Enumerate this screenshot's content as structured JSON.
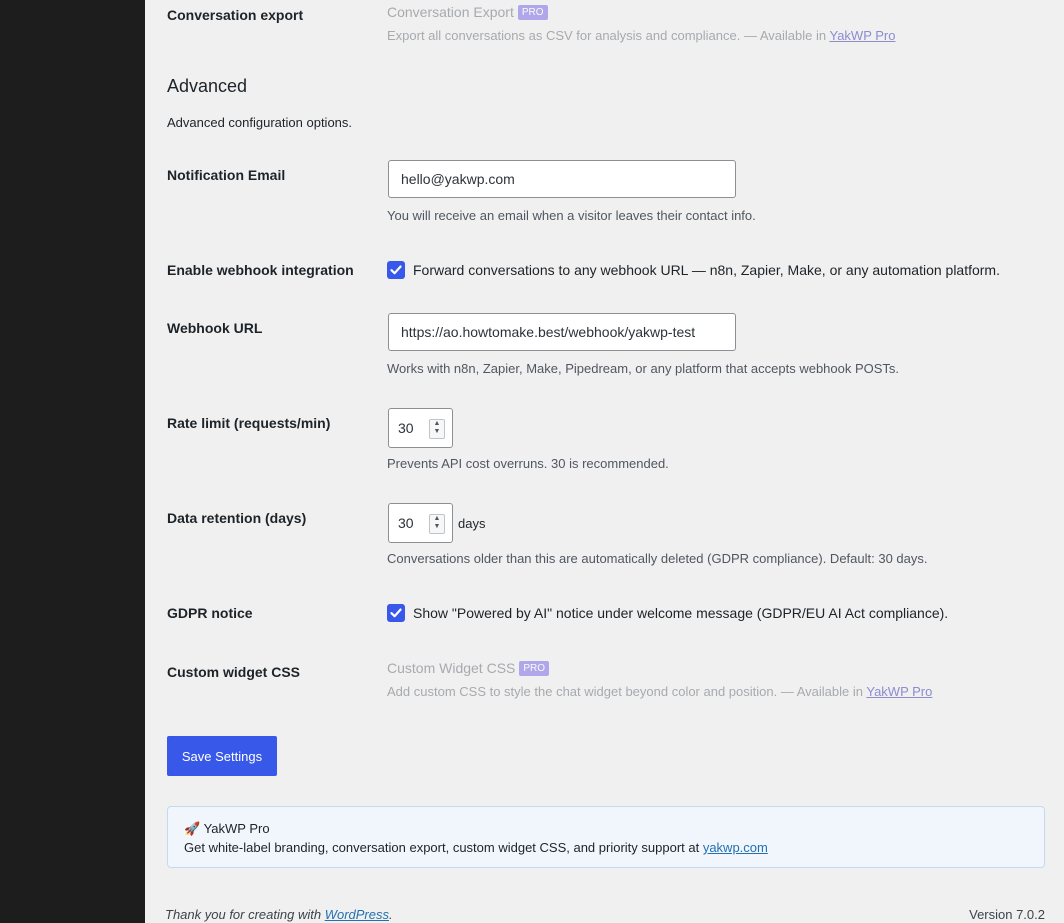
{
  "conversation_export": {
    "label": "Conversation export",
    "title": "Conversation Export",
    "badge": "PRO",
    "desc_prefix": "Export all conversations as CSV for analysis and compliance. — Available in ",
    "link_text": "YakWP Pro"
  },
  "advanced": {
    "title": "Advanced",
    "description": "Advanced configuration options."
  },
  "notification_email": {
    "label": "Notification Email",
    "value": "hello@yakwp.com",
    "description": "You will receive an email when a visitor leaves their contact info."
  },
  "webhook_enable": {
    "label": "Enable webhook integration",
    "checked": true,
    "checkbox_label": "Forward conversations to any webhook URL — n8n, Zapier, Make, or any automation platform."
  },
  "webhook_url": {
    "label": "Webhook URL",
    "value": "https://ao.howtomake.best/webhook/yakwp-test",
    "description": "Works with n8n, Zapier, Make, Pipedream, or any platform that accepts webhook POSTs."
  },
  "rate_limit": {
    "label": "Rate limit (requests/min)",
    "value": "30",
    "description": "Prevents API cost overruns. 30 is recommended."
  },
  "data_retention": {
    "label": "Data retention (days)",
    "value": "30",
    "suffix": "days",
    "description": "Conversations older than this are automatically deleted (GDPR compliance). Default: 30 days."
  },
  "gdpr_notice": {
    "label": "GDPR notice",
    "checked": true,
    "checkbox_label": "Show \"Powered by AI\" notice under welcome message (GDPR/EU AI Act compliance)."
  },
  "custom_css": {
    "label": "Custom widget CSS",
    "title": "Custom Widget CSS",
    "badge": "PRO",
    "desc_prefix": "Add custom CSS to style the chat widget beyond color and position. — Available in ",
    "link_text": "YakWP Pro"
  },
  "save_button": "Save Settings",
  "promo": {
    "icon": "rocket-icon",
    "title": "🚀 YakWP Pro",
    "text_prefix": "Get white-label branding, conversation export, custom widget CSS, and priority support at ",
    "link_text": "yakwp.com"
  },
  "footer": {
    "thanks_prefix": "Thank you for creating with ",
    "thanks_link": "WordPress",
    "thanks_suffix": ".",
    "version": "Version 7.0.2"
  },
  "colors": {
    "accent": "#3858e9",
    "sidebar": "#1d1d1d",
    "background": "#f0f0f1",
    "pro_badge": "#9b8fe8"
  }
}
